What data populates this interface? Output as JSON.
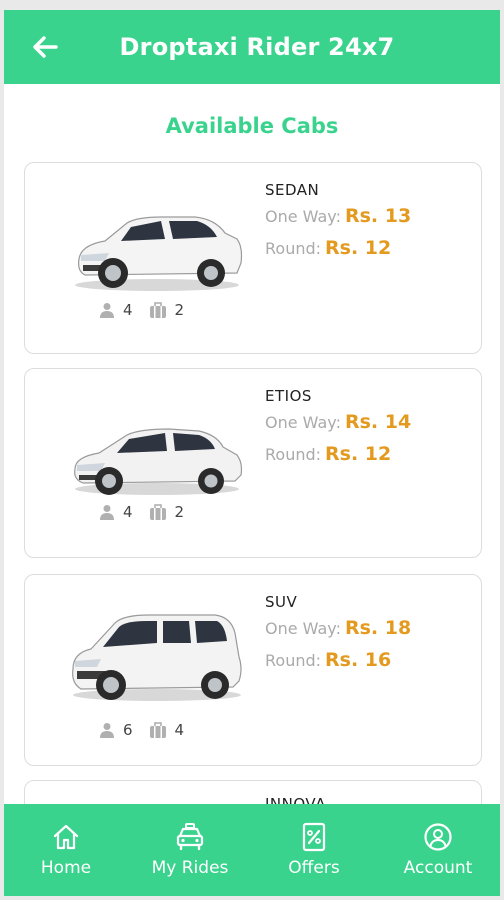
{
  "header": {
    "title": "Droptaxi Rider 24x7",
    "back_icon": "arrow-left-icon"
  },
  "section_title": "Available Cabs",
  "cabs": [
    {
      "name": "SEDAN",
      "one_way_label": "One Way:",
      "one_way_price": "Rs. 13",
      "round_label": "Round:",
      "round_price": "Rs. 12",
      "seats": "4",
      "bags": "2",
      "color": "#f2f2f2"
    },
    {
      "name": "ETIOS",
      "one_way_label": "One Way:",
      "one_way_price": "Rs. 14",
      "round_label": "Round:",
      "round_price": "Rs. 12",
      "seats": "4",
      "bags": "2",
      "color": "#f2f2f2"
    },
    {
      "name": "SUV",
      "one_way_label": "One Way:",
      "one_way_price": "Rs. 18",
      "round_label": "Round:",
      "round_price": "Rs. 16",
      "seats": "6",
      "bags": "4",
      "color": "#f2f2f2"
    },
    {
      "name": "INNOVA"
    }
  ],
  "nav": [
    {
      "label": "Home",
      "icon": "home-icon"
    },
    {
      "label": "My Rides",
      "icon": "taxi-icon"
    },
    {
      "label": "Offers",
      "icon": "discount-icon"
    },
    {
      "label": "Account",
      "icon": "user-circle-icon"
    }
  ],
  "colors": {
    "primary": "#3ad38e",
    "price": "#e39a1f",
    "muted": "#aaaaaa"
  }
}
